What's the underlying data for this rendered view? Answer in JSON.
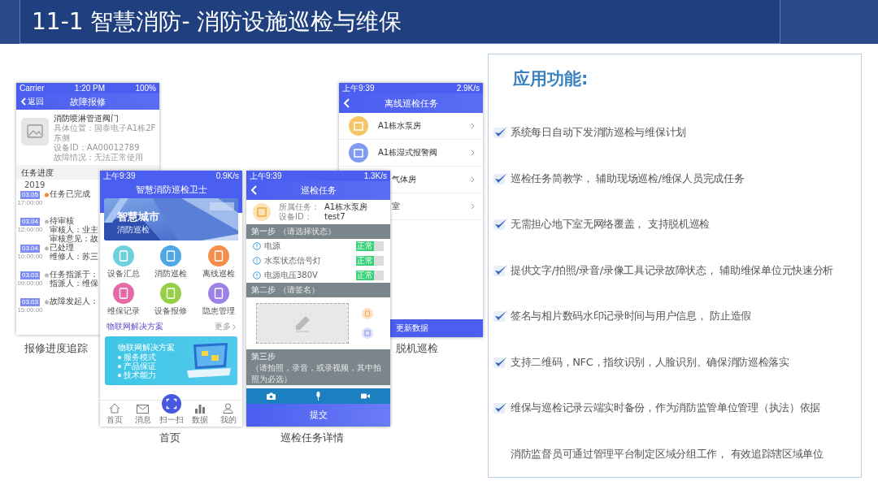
{
  "slide_title": "11-1 智慧消防- 消防设施巡检与维保",
  "repair_screen": {
    "status": {
      "carrier": "Carrier",
      "time": "1:20 PM",
      "battery": "100%"
    },
    "back": "返回",
    "title": "故障报修",
    "device": {
      "name": "消防喷淋管道阀门",
      "lines": [
        "具体位置：国泰电子A1栋2F东侧",
        "设备ID：AA00012789",
        "故障情况：无法正常使用"
      ]
    },
    "progress_title": "任务进度",
    "year": "2019",
    "timeline": [
      {
        "date": "03.05",
        "time": "17:00:00",
        "lines": [
          "任务已完成"
        ],
        "active": true
      },
      {
        "date": "03.04",
        "time": "12:00:00",
        "lines": [
          "待审核",
          "审核人：业主",
          "审核意见：故"
        ],
        "active": false
      },
      {
        "date": "03.04",
        "time": "10:00:00",
        "lines": [
          "已处理",
          "维修人：苏三"
        ],
        "active": false
      },
      {
        "date": "03.03",
        "time": "09:00:00",
        "lines": [
          "任务指派于：",
          "指派人：维保"
        ],
        "active": false
      },
      {
        "date": "03.03",
        "time": "15:00:00",
        "lines": [
          "故障发起人："
        ],
        "active": false
      }
    ]
  },
  "offline_screen": {
    "status": {
      "time": "上午9:39",
      "speed": "2.9K/s"
    },
    "title": "离线巡检任务",
    "tasks": [
      {
        "label": "A1栋水泵房",
        "color": "#f5c56a"
      },
      {
        "label": "A1栋湿式报警阀",
        "color": "#7f9cf0"
      },
      {
        "label": "气体房"
      },
      {
        "label": "室"
      }
    ],
    "update": "更新数据"
  },
  "home_screen": {
    "status": {
      "time": "上午9:39",
      "speed": "0.9K/s"
    },
    "title": "智慧消防巡检卫士",
    "banner": {
      "title": "智慧城市",
      "subtitle": "消防巡检"
    },
    "tiles": [
      {
        "label": "设备汇总",
        "color": "#6fd0dc"
      },
      {
        "label": "消防巡检",
        "color": "#4ea8e6"
      },
      {
        "label": "离线巡检",
        "color": "#f28e4a"
      },
      {
        "label": "维保记录",
        "color": "#e56aa8"
      },
      {
        "label": "设备报修",
        "color": "#96cf45"
      },
      {
        "label": "隐患管理",
        "color": "#9d82e6"
      }
    ],
    "section": {
      "title": "物联网解决方案",
      "more": "更多"
    },
    "card": {
      "title": "物联网解决方案",
      "bullets": [
        "服务模式",
        "产品保证",
        "技术能力"
      ]
    },
    "nav": [
      {
        "label": "首页",
        "kind": "home"
      },
      {
        "label": "消息",
        "kind": "message"
      },
      {
        "label": "扫一扫",
        "kind": "scan"
      },
      {
        "label": "数据",
        "kind": "data"
      },
      {
        "label": "我的",
        "kind": "me"
      }
    ]
  },
  "task_screen": {
    "status": {
      "time": "上午9:39",
      "speed": "1.3K/s"
    },
    "title": "巡检任务",
    "info": [
      {
        "label": "所属任务：",
        "value": "A1栋水泵房"
      },
      {
        "label": "设备ID：",
        "value": "test7"
      }
    ],
    "step1": {
      "title": "第一步",
      "hint": "（请选择状态）",
      "checks": [
        {
          "label": "电源",
          "status": "正常",
          "on": true
        },
        {
          "label": "水泵状态信号灯",
          "status": "正常",
          "on": true
        },
        {
          "label": "电源电压380V",
          "status": "正常",
          "on": true
        }
      ]
    },
    "step2": {
      "title": "第二步",
      "hint": "（请签名）"
    },
    "step3": {
      "title": "第三步",
      "hint": "（请拍照，录音，或录视频，其中拍照为必选）"
    },
    "submit": "提交"
  },
  "captions": [
    "报修进度追踪",
    "脱机巡检",
    "首页",
    "巡检任务详情"
  ],
  "features": {
    "title": "应用功能:",
    "items": [
      {
        "kind": "check",
        "text": "系统每日自动下发消防巡检与维保计划"
      },
      {
        "kind": "check",
        "text": "巡检任务简教学， 辅助现场巡检/维保人员完成任务"
      },
      {
        "kind": "check",
        "text": "无需担心地下室无网络覆盖， 支持脱机巡检"
      },
      {
        "kind": "check",
        "text": "提供文字/拍照/录音/录像工具记录故障状态， 辅助维保单位元快速分析"
      },
      {
        "kind": "check",
        "text": "签名与相片数码水印记录时间与用户信息， 防止造假"
      },
      {
        "kind": "check",
        "text": "支持二维码，NFC，指纹识别，人脸识别。确保消防巡检落实"
      },
      {
        "kind": "check",
        "text": "维保与巡检记录云端实时备份，作为消防监管单位管理（执法）依据"
      },
      {
        "kind": "plain",
        "text": "消防监督员可通过管理平台制定区域分组工作， 有效追踪辖区域单位"
      }
    ]
  }
}
